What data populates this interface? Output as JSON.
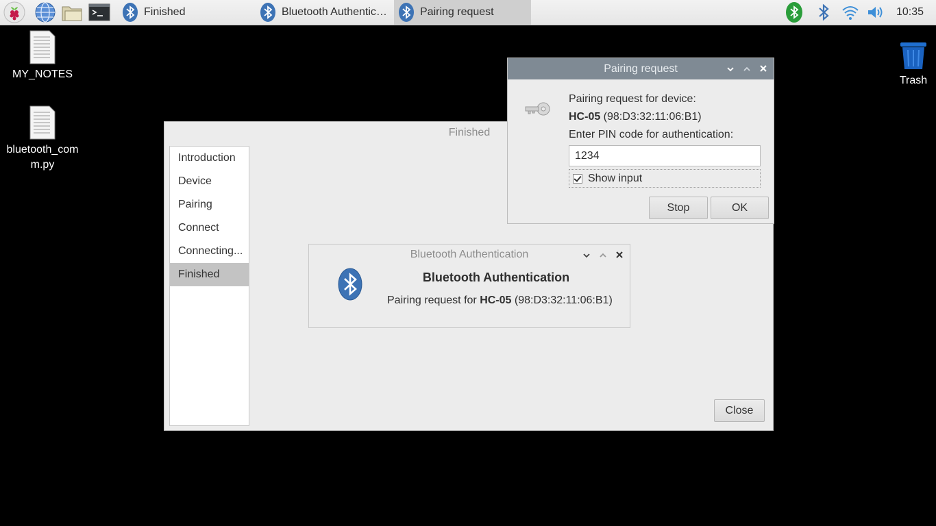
{
  "taskbar": {
    "tasks": [
      {
        "label": "Finished",
        "active": false
      },
      {
        "label": "Bluetooth Authenticat...",
        "active": false
      },
      {
        "label": "Pairing request",
        "active": true
      }
    ],
    "clock": "10:35"
  },
  "desktop": {
    "items": [
      {
        "label": "MY_NOTES"
      },
      {
        "label": "bluetooth_comm.py"
      },
      {
        "label": "Trash"
      }
    ]
  },
  "main_window": {
    "title": "Finished",
    "sidebar": [
      "Introduction",
      "Device",
      "Pairing",
      "Connect",
      "Connecting...",
      "Finished"
    ],
    "selected": "Finished",
    "close_button": "Close"
  },
  "auth_dialog": {
    "title": "Bluetooth Authentication",
    "heading": "Bluetooth Authentication",
    "message_prefix": "Pairing request for ",
    "device_name": "HC-05",
    "device_addr": " (98:D3:32:11:06:B1)"
  },
  "pairing_dialog": {
    "title": "Pairing request",
    "line1": "Pairing request for device:",
    "device_name": "HC-05",
    "device_addr": " (98:D3:32:11:06:B1)",
    "prompt": "Enter PIN code for authentication:",
    "pin_value": "1234",
    "show_input_label": "Show input",
    "show_input_checked": true,
    "stop_button": "Stop",
    "ok_button": "OK"
  },
  "colors": {
    "bluetooth": "#3d73b5",
    "bluetooth_active": "#2a9d3a",
    "titlebar_active": "#7f8a94"
  }
}
